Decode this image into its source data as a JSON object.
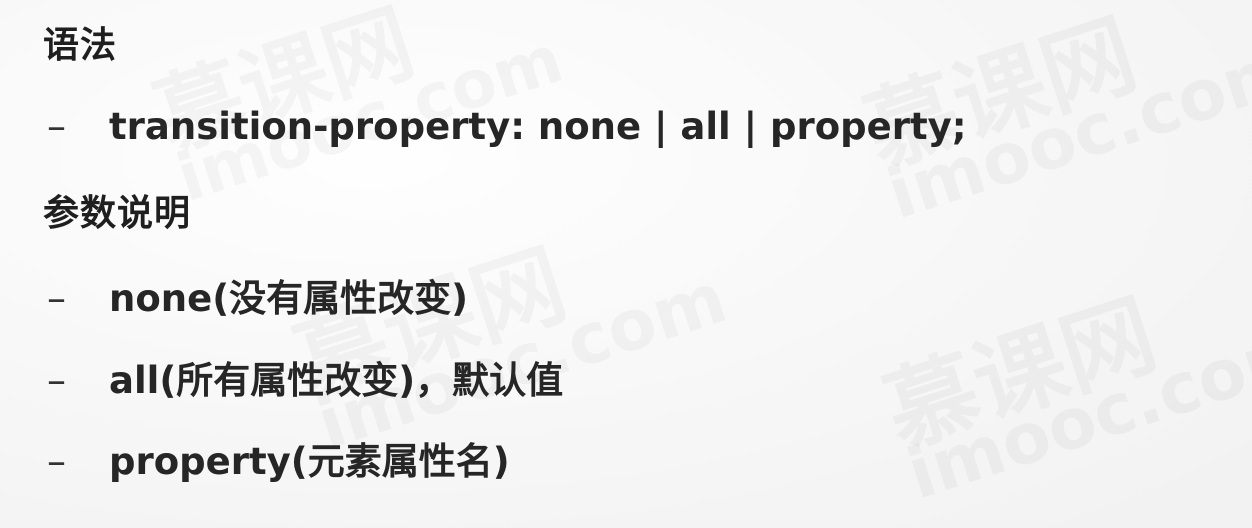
{
  "watermark": {
    "brand_cn": "慕课网",
    "domain": "imooc.com"
  },
  "syntax_section": {
    "heading": "语法",
    "items": [
      "transition-property: none | all | property;"
    ]
  },
  "params_section": {
    "heading": "参数说明",
    "items": [
      "none(没有属性改变)",
      "all(所有属性改变)，默认值",
      "property(元素属性名)"
    ]
  },
  "bullet_symbol": "–"
}
